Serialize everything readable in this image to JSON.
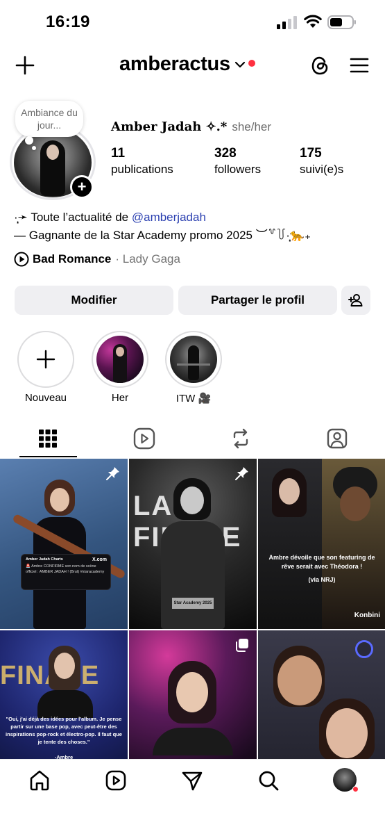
{
  "status_bar": {
    "time": "16:19"
  },
  "header": {
    "username": "amberactus"
  },
  "profile": {
    "note": "Ambiance du jour...",
    "display_name": "Amber Jadah ✧.*",
    "pronouns": "she/her",
    "stats": [
      {
        "value": "11",
        "label": "publications"
      },
      {
        "value": "328",
        "label": "followers"
      },
      {
        "value": "175",
        "label": "suivi(e)s"
      }
    ],
    "bio_line1_prefix": "·̩͙➛ Toute l’actualité de ",
    "bio_link": "@amberjadah",
    "bio_line2": "— Gagnante de la Star Academy promo 2025 ︶꒷꒦·̩͙🐆₊",
    "music": {
      "song": "Bad Romance",
      "artist": "· Lady Gaga"
    }
  },
  "buttons": {
    "edit": "Modifier",
    "share": "Partager le profil"
  },
  "highlights": [
    {
      "label": "Nouveau"
    },
    {
      "label": "Her"
    },
    {
      "label": "ITW 🎥"
    }
  ],
  "tabs": [
    "grid-tab",
    "reels-tab",
    "reposts-tab",
    "tagged-tab"
  ],
  "posts": [
    {
      "caption_account": "Amber Jadah Charts",
      "caption": "🚨 Ambre CONFIRME son nom de scène officiel : AMBER JADAH ! (Brut) #staracademy",
      "tag": "X.com"
    },
    {
      "overlay": "Star Academy 2025"
    },
    {
      "caption": "Ambre dévoile que son featuring de rêve serait avec Théodora !",
      "source": "(via NRJ)",
      "tag": "Konbini"
    },
    {
      "caption": "\"Oui, j'ai déjà des idées pour l'album. Je pense partir sur une base pop, avec peut-être des inspirations pop-rock et électro-pop. Il faut que je tente des choses.\"",
      "signature": "-Ambre"
    },
    {
      "overlay": ""
    },
    {
      "overlay": ""
    }
  ],
  "colors": {
    "link": "#2a3fb0",
    "notification": "#ff3040",
    "button_bg": "#efeff2"
  }
}
